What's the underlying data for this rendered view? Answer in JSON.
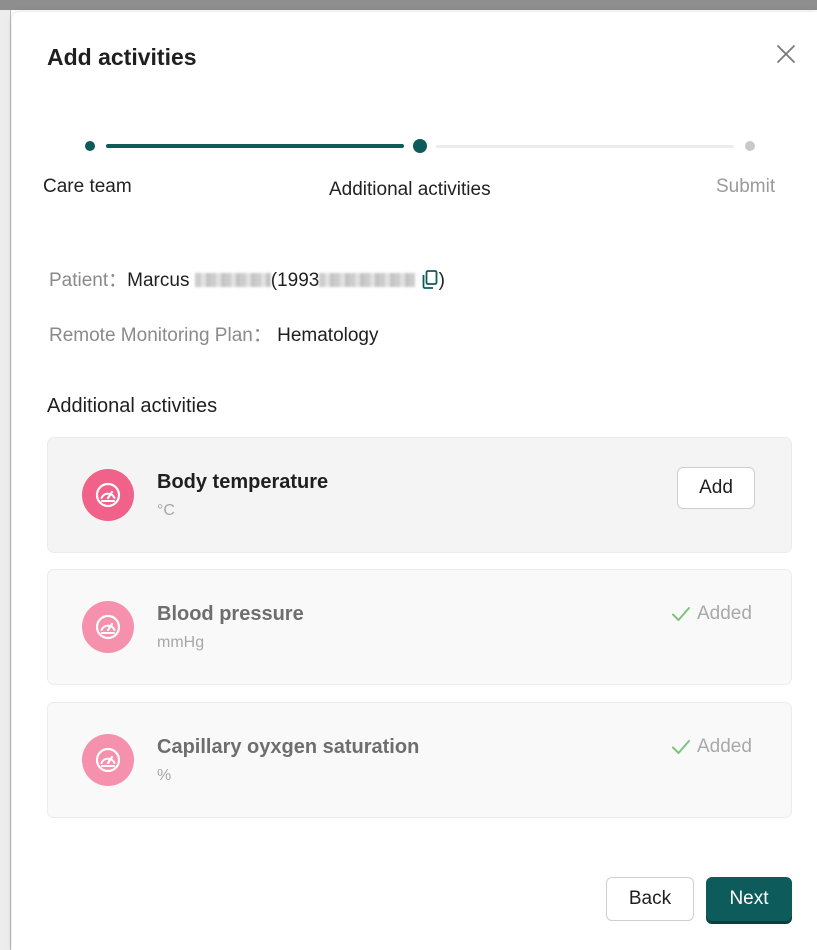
{
  "dialog": {
    "title": "Add activities"
  },
  "stepper": {
    "steps": [
      {
        "label": "Care team",
        "state": "complete"
      },
      {
        "label": "Additional activities",
        "state": "current"
      },
      {
        "label": "Submit",
        "state": "pending"
      }
    ]
  },
  "patient": {
    "label": "Patient：",
    "first_name": "Marcus",
    "id_prefix": "(1993",
    "close_paren": ")"
  },
  "plan": {
    "label": "Remote Monitoring Plan：",
    "value": "Hematology"
  },
  "section_title": "Additional activities",
  "activities": [
    {
      "name": "Body temperature",
      "unit": "°C",
      "action": "Add",
      "icon": "gauge-icon"
    },
    {
      "name": "Blood pressure",
      "unit": "mmHg",
      "status": "Added",
      "icon": "gauge-icon"
    },
    {
      "name": "Capillary oyxgen saturation",
      "unit": "%",
      "status": "Added",
      "icon": "gauge-icon"
    }
  ],
  "footer": {
    "back_label": "Back",
    "next_label": "Next"
  },
  "colors": {
    "primary": "#0e5b5b",
    "icon_active": "#f0628a",
    "icon_muted": "#f590ad",
    "added_check": "#7cc47a"
  }
}
